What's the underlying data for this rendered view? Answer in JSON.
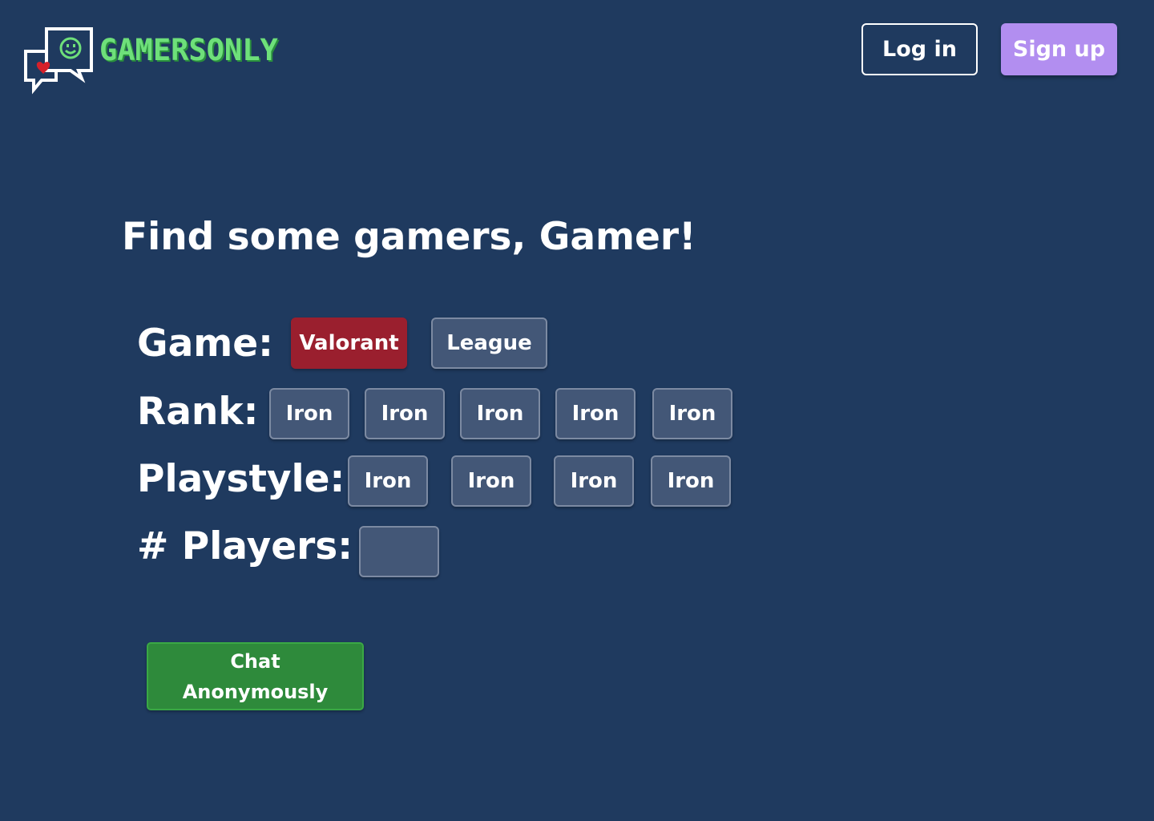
{
  "header": {
    "brand": "GAMERSONLY",
    "login_label": "Log in",
    "signup_label": "Sign up"
  },
  "main": {
    "title": "Find some gamers, Gamer!",
    "game": {
      "label": "Game:",
      "options": [
        "Valorant",
        "League"
      ],
      "selected": "Valorant"
    },
    "rank": {
      "label": "Rank:",
      "options": [
        "Iron",
        "Iron",
        "Iron",
        "Iron",
        "Iron"
      ]
    },
    "playstyle": {
      "label": "Playstyle:",
      "options": [
        "Iron",
        "Iron",
        "Iron",
        "Iron"
      ]
    },
    "players": {
      "label": "# Players:",
      "value": ""
    },
    "chat_button": {
      "line1": "Chat",
      "line2": "Anonymously"
    }
  },
  "colors": {
    "background": "#1f3a5f",
    "brand_green": "#6ee07a",
    "signup_purple": "#b28ef0",
    "selected_red": "#9a1f2e",
    "option_bg": "#435777",
    "chat_green": "#2e8a3b"
  },
  "icons": {
    "logo": "chat-bubbles-logo-icon"
  }
}
